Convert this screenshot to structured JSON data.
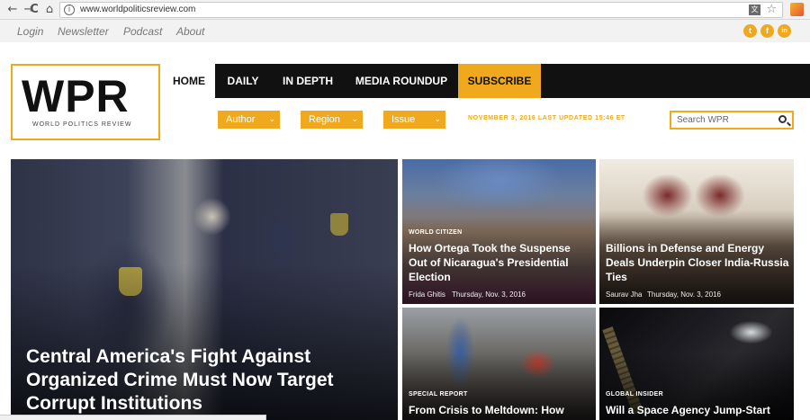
{
  "browser": {
    "back": "←",
    "forward": "→",
    "reload": "C",
    "home": "⌂",
    "url": "www.worldpoliticsreview.com",
    "info_glyph": "i",
    "star": "☆"
  },
  "utility": {
    "links": [
      "Login",
      "Newsletter",
      "Podcast",
      "About"
    ],
    "social": [
      {
        "icon": "twitter-icon",
        "glyph": "t"
      },
      {
        "icon": "facebook-icon",
        "glyph": "f"
      },
      {
        "icon": "linkedin-icon",
        "glyph": "in"
      }
    ]
  },
  "logo": {
    "wordmark": "WPR",
    "tagline": "WORLD POLITICS REVIEW"
  },
  "nav": {
    "items": [
      "HOME",
      "DAILY",
      "IN DEPTH",
      "MEDIA ROUNDUP",
      "SUBSCRIBE"
    ]
  },
  "filters": {
    "author": "Author",
    "region": "Region",
    "issue": "Issue",
    "chevron": "⌄"
  },
  "dateline": "NOVEMBER 3, 2016 LAST UPDATED 15:46 ET",
  "search": {
    "placeholder": "Search WPR"
  },
  "hero": {
    "headline": "Central America's Fight Against Organized Crime Must Now Target Corrupt Institutions"
  },
  "cards": [
    {
      "kicker": "WORLD CITIZEN",
      "headline": "How Ortega Took the Suspense Out of Nicaragua's Presidential Election",
      "author": "Frida Ghitis",
      "date": "Thursday, Nov. 3, 2016"
    },
    {
      "kicker": "",
      "headline": "Billions in Defense and Energy Deals Underpin Closer India-Russia Ties",
      "author": "Saurav Jha",
      "date": "Thursday, Nov. 3, 2016"
    },
    {
      "kicker": "SPECIAL REPORT",
      "headline": "From Crisis to Meltdown: How",
      "author": "",
      "date": ""
    },
    {
      "kicker": "GLOBAL INSIDER",
      "headline": "Will a Space Agency Jump-Start",
      "author": "",
      "date": ""
    }
  ],
  "colors": {
    "accent": "#f0a91c",
    "nav_bg": "#111111"
  }
}
